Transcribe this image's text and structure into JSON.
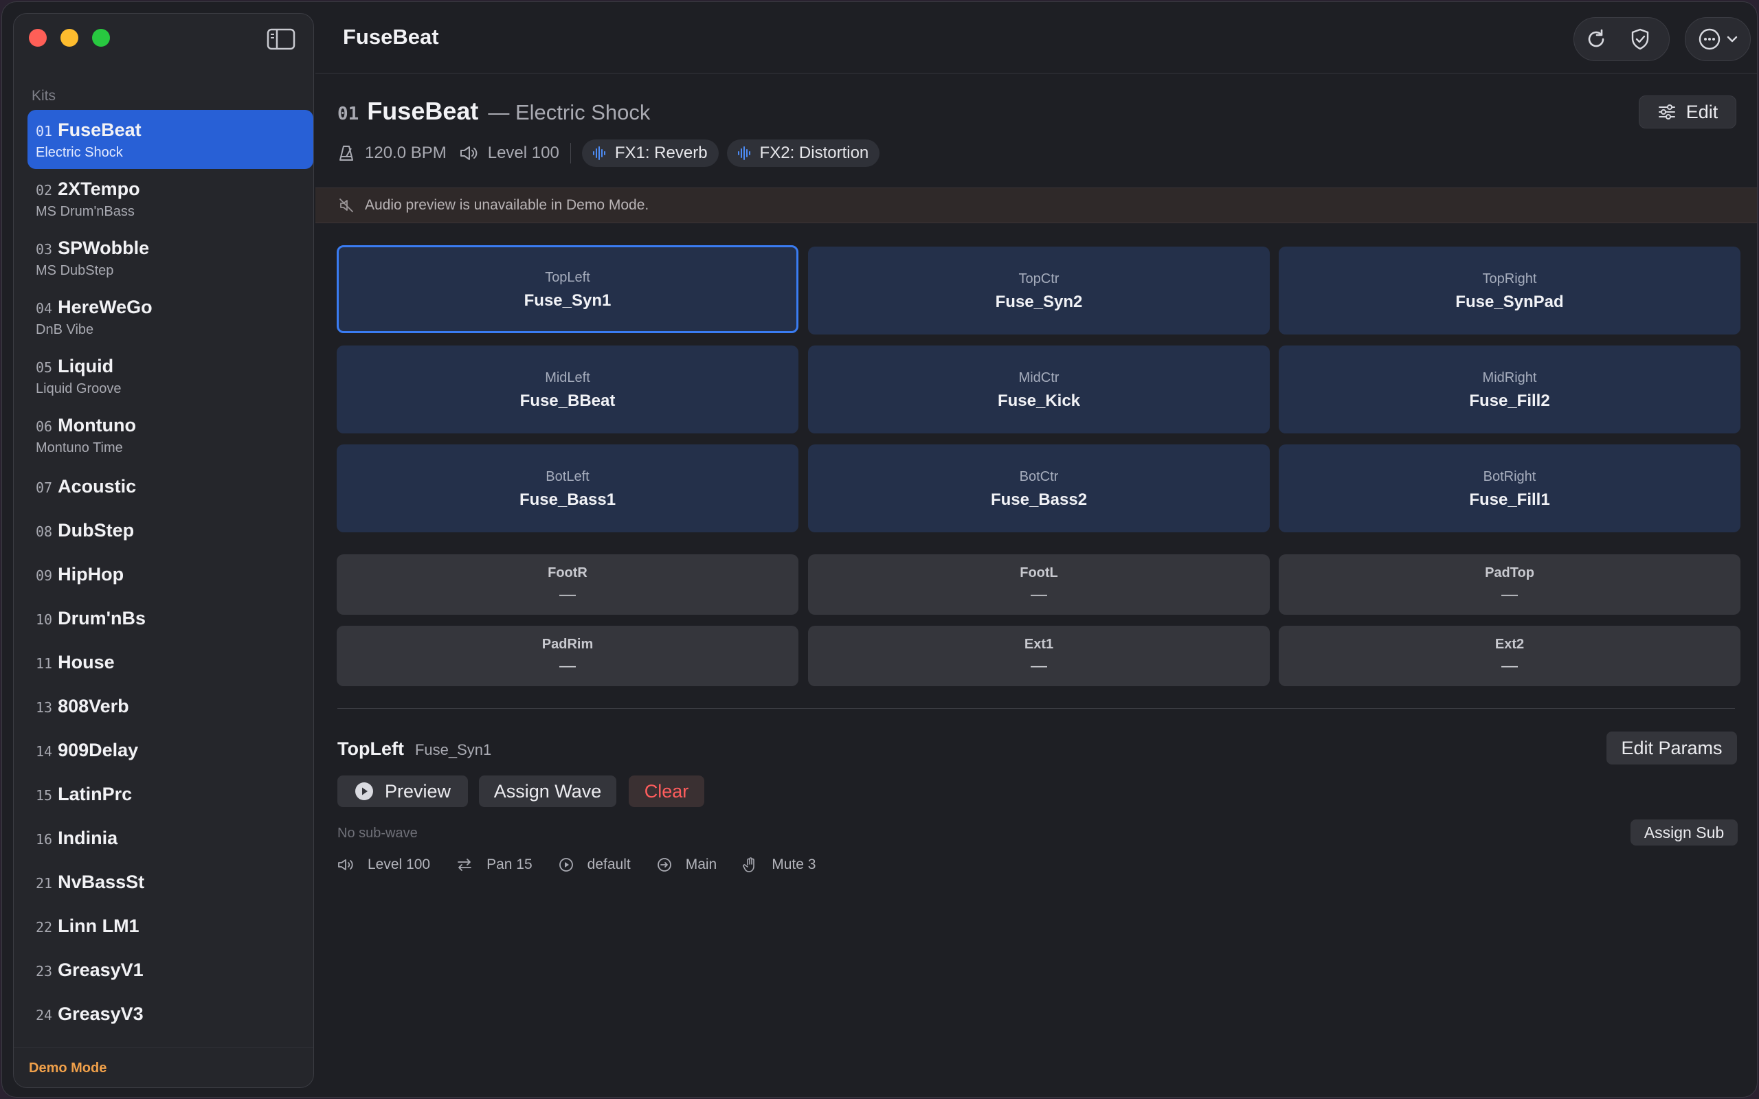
{
  "app": {
    "title": "FuseBeat"
  },
  "sidebar": {
    "section_label": "Kits",
    "kits": [
      {
        "num": "01",
        "name": "FuseBeat",
        "sub": "Electric Shock",
        "active": true
      },
      {
        "num": "02",
        "name": "2XTempo",
        "sub": "MS Drum'nBass"
      },
      {
        "num": "03",
        "name": "SPWobble",
        "sub": "MS DubStep"
      },
      {
        "num": "04",
        "name": "HereWeGo",
        "sub": "DnB Vibe"
      },
      {
        "num": "05",
        "name": "Liquid",
        "sub": "Liquid Groove"
      },
      {
        "num": "06",
        "name": "Montuno",
        "sub": "Montuno Time"
      },
      {
        "num": "07",
        "name": "Acoustic"
      },
      {
        "num": "08",
        "name": "DubStep"
      },
      {
        "num": "09",
        "name": "HipHop"
      },
      {
        "num": "10",
        "name": "Drum'nBs"
      },
      {
        "num": "11",
        "name": "House"
      },
      {
        "num": "13",
        "name": "808Verb"
      },
      {
        "num": "14",
        "name": "909Delay"
      },
      {
        "num": "15",
        "name": "LatinPrc"
      },
      {
        "num": "16",
        "name": "Indinia"
      },
      {
        "num": "21",
        "name": "NvBassSt"
      },
      {
        "num": "22",
        "name": "Linn LM1"
      },
      {
        "num": "23",
        "name": "GreasyV1"
      },
      {
        "num": "24",
        "name": "GreasyV3"
      }
    ],
    "footer": "Demo Mode"
  },
  "toolbar": {
    "icons": [
      "refresh-icon",
      "shield-check-icon",
      "more-icon",
      "chevron-down-icon"
    ]
  },
  "kit": {
    "num": "01",
    "name": "FuseBeat",
    "subtitle": "— Electric Shock",
    "bpm": "120.0 BPM",
    "level": "Level 100",
    "fx1": "FX1: Reverb",
    "fx2": "FX2: Distortion",
    "edit_label": "Edit"
  },
  "banner": {
    "text": "Audio preview is unavailable in Demo Mode."
  },
  "pads": [
    {
      "slot": "TopLeft",
      "wave": "Fuse_Syn1",
      "selected": true
    },
    {
      "slot": "TopCtr",
      "wave": "Fuse_Syn2"
    },
    {
      "slot": "TopRight",
      "wave": "Fuse_SynPad"
    },
    {
      "slot": "MidLeft",
      "wave": "Fuse_BBeat"
    },
    {
      "slot": "MidCtr",
      "wave": "Fuse_Kick"
    },
    {
      "slot": "MidRight",
      "wave": "Fuse_Fill2"
    },
    {
      "slot": "BotLeft",
      "wave": "Fuse_Bass1"
    },
    {
      "slot": "BotCtr",
      "wave": "Fuse_Bass2"
    },
    {
      "slot": "BotRight",
      "wave": "Fuse_Fill1"
    }
  ],
  "triggers": [
    {
      "slot": "FootR",
      "wave": "—"
    },
    {
      "slot": "FootL",
      "wave": "—"
    },
    {
      "slot": "PadTop",
      "wave": "—"
    },
    {
      "slot": "PadRim",
      "wave": "—"
    },
    {
      "slot": "Ext1",
      "wave": "—"
    },
    {
      "slot": "Ext2",
      "wave": "—"
    }
  ],
  "detail": {
    "slot": "TopLeft",
    "wave": "Fuse_Syn1",
    "edit_params_label": "Edit Params",
    "preview_label": "Preview",
    "assign_wave_label": "Assign Wave",
    "clear_label": "Clear",
    "no_sub": "No sub-wave",
    "assign_sub_label": "Assign Sub",
    "level": "Level 100",
    "pan": "Pan 15",
    "playback": "default",
    "output": "Main",
    "mute": "Mute 3"
  },
  "colors": {
    "accent": "#2860d6",
    "selection_border": "#3a7cf2",
    "demo": "#f0a04a",
    "danger": "#ff5d5d"
  }
}
